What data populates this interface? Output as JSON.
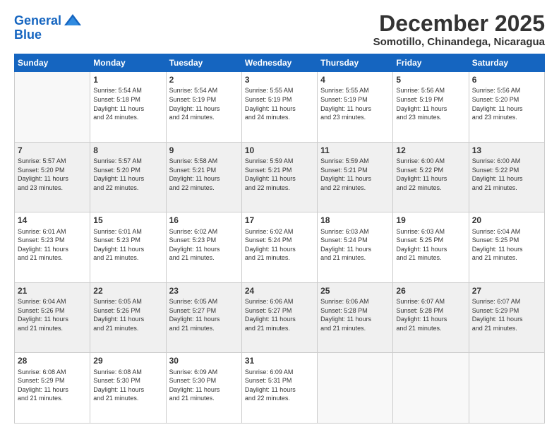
{
  "logo": {
    "line1": "General",
    "line2": "Blue"
  },
  "header": {
    "month": "December 2025",
    "location": "Somotillo, Chinandega, Nicaragua"
  },
  "weekdays": [
    "Sunday",
    "Monday",
    "Tuesday",
    "Wednesday",
    "Thursday",
    "Friday",
    "Saturday"
  ],
  "weeks": [
    [
      {
        "day": "",
        "info": ""
      },
      {
        "day": "1",
        "info": "Sunrise: 5:54 AM\nSunset: 5:18 PM\nDaylight: 11 hours\nand 24 minutes."
      },
      {
        "day": "2",
        "info": "Sunrise: 5:54 AM\nSunset: 5:19 PM\nDaylight: 11 hours\nand 24 minutes."
      },
      {
        "day": "3",
        "info": "Sunrise: 5:55 AM\nSunset: 5:19 PM\nDaylight: 11 hours\nand 24 minutes."
      },
      {
        "day": "4",
        "info": "Sunrise: 5:55 AM\nSunset: 5:19 PM\nDaylight: 11 hours\nand 23 minutes."
      },
      {
        "day": "5",
        "info": "Sunrise: 5:56 AM\nSunset: 5:19 PM\nDaylight: 11 hours\nand 23 minutes."
      },
      {
        "day": "6",
        "info": "Sunrise: 5:56 AM\nSunset: 5:20 PM\nDaylight: 11 hours\nand 23 minutes."
      }
    ],
    [
      {
        "day": "7",
        "info": "Sunrise: 5:57 AM\nSunset: 5:20 PM\nDaylight: 11 hours\nand 23 minutes."
      },
      {
        "day": "8",
        "info": "Sunrise: 5:57 AM\nSunset: 5:20 PM\nDaylight: 11 hours\nand 22 minutes."
      },
      {
        "day": "9",
        "info": "Sunrise: 5:58 AM\nSunset: 5:21 PM\nDaylight: 11 hours\nand 22 minutes."
      },
      {
        "day": "10",
        "info": "Sunrise: 5:59 AM\nSunset: 5:21 PM\nDaylight: 11 hours\nand 22 minutes."
      },
      {
        "day": "11",
        "info": "Sunrise: 5:59 AM\nSunset: 5:21 PM\nDaylight: 11 hours\nand 22 minutes."
      },
      {
        "day": "12",
        "info": "Sunrise: 6:00 AM\nSunset: 5:22 PM\nDaylight: 11 hours\nand 22 minutes."
      },
      {
        "day": "13",
        "info": "Sunrise: 6:00 AM\nSunset: 5:22 PM\nDaylight: 11 hours\nand 21 minutes."
      }
    ],
    [
      {
        "day": "14",
        "info": "Sunrise: 6:01 AM\nSunset: 5:23 PM\nDaylight: 11 hours\nand 21 minutes."
      },
      {
        "day": "15",
        "info": "Sunrise: 6:01 AM\nSunset: 5:23 PM\nDaylight: 11 hours\nand 21 minutes."
      },
      {
        "day": "16",
        "info": "Sunrise: 6:02 AM\nSunset: 5:23 PM\nDaylight: 11 hours\nand 21 minutes."
      },
      {
        "day": "17",
        "info": "Sunrise: 6:02 AM\nSunset: 5:24 PM\nDaylight: 11 hours\nand 21 minutes."
      },
      {
        "day": "18",
        "info": "Sunrise: 6:03 AM\nSunset: 5:24 PM\nDaylight: 11 hours\nand 21 minutes."
      },
      {
        "day": "19",
        "info": "Sunrise: 6:03 AM\nSunset: 5:25 PM\nDaylight: 11 hours\nand 21 minutes."
      },
      {
        "day": "20",
        "info": "Sunrise: 6:04 AM\nSunset: 5:25 PM\nDaylight: 11 hours\nand 21 minutes."
      }
    ],
    [
      {
        "day": "21",
        "info": "Sunrise: 6:04 AM\nSunset: 5:26 PM\nDaylight: 11 hours\nand 21 minutes."
      },
      {
        "day": "22",
        "info": "Sunrise: 6:05 AM\nSunset: 5:26 PM\nDaylight: 11 hours\nand 21 minutes."
      },
      {
        "day": "23",
        "info": "Sunrise: 6:05 AM\nSunset: 5:27 PM\nDaylight: 11 hours\nand 21 minutes."
      },
      {
        "day": "24",
        "info": "Sunrise: 6:06 AM\nSunset: 5:27 PM\nDaylight: 11 hours\nand 21 minutes."
      },
      {
        "day": "25",
        "info": "Sunrise: 6:06 AM\nSunset: 5:28 PM\nDaylight: 11 hours\nand 21 minutes."
      },
      {
        "day": "26",
        "info": "Sunrise: 6:07 AM\nSunset: 5:28 PM\nDaylight: 11 hours\nand 21 minutes."
      },
      {
        "day": "27",
        "info": "Sunrise: 6:07 AM\nSunset: 5:29 PM\nDaylight: 11 hours\nand 21 minutes."
      }
    ],
    [
      {
        "day": "28",
        "info": "Sunrise: 6:08 AM\nSunset: 5:29 PM\nDaylight: 11 hours\nand 21 minutes."
      },
      {
        "day": "29",
        "info": "Sunrise: 6:08 AM\nSunset: 5:30 PM\nDaylight: 11 hours\nand 21 minutes."
      },
      {
        "day": "30",
        "info": "Sunrise: 6:09 AM\nSunset: 5:30 PM\nDaylight: 11 hours\nand 21 minutes."
      },
      {
        "day": "31",
        "info": "Sunrise: 6:09 AM\nSunset: 5:31 PM\nDaylight: 11 hours\nand 22 minutes."
      },
      {
        "day": "",
        "info": ""
      },
      {
        "day": "",
        "info": ""
      },
      {
        "day": "",
        "info": ""
      }
    ]
  ]
}
